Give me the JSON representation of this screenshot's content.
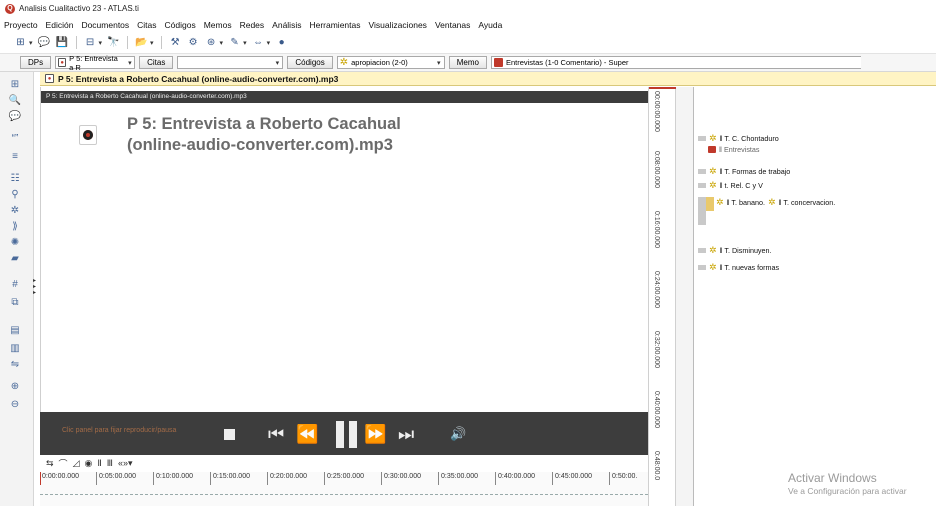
{
  "window": {
    "title": "Analisis Cualitactivo 23 - ATLAS.ti"
  },
  "menu": [
    "Proyecto",
    "Edición",
    "Documentos",
    "Citas",
    "Códigos",
    "Memos",
    "Redes",
    "Análisis",
    "Herramientas",
    "Visualizaciones",
    "Ventanas",
    "Ayuda"
  ],
  "toolbar2": {
    "dps_label": "DPs",
    "doc_select": "P 5: Entrevista a R",
    "citas_label": "Citas",
    "citas_select": "",
    "codigos_label": "Códigos",
    "codigos_select": "apropiacion (2-0)",
    "memo_label": "Memo",
    "memo_select": "Entrevistas (1-0 Comentario) - Super"
  },
  "document": {
    "header": "P 5: Entrevista a Roberto Cacahual (online-audio-converter.com).mp3",
    "bar": "P 5: Entrevista a Roberto Cacahual (online-audio-converter.com).mp3",
    "title_line1": "P 5: Entrevista a Roberto Cacahual",
    "title_line2": "(online-audio-converter.com).mp3"
  },
  "player": {
    "hint": "Clic panel para fijar reproducir/pausa",
    "prev_glyph": "⏮",
    "rew_glyph": "⏪",
    "fwd_glyph": "⏩",
    "next_glyph": "⏭",
    "vol_glyph": "🔊"
  },
  "timeline": {
    "tools": [
      "⇆",
      "⌒",
      "◿",
      "◉",
      "Ⅱ",
      "Ⅲ",
      "«»▾"
    ],
    "ticks": [
      "0:00:00.000",
      "0:05:00.000",
      "0:10:00.000",
      "0:15:00.000",
      "0:20:00.000",
      "0:25:00.000",
      "0:30:00.000",
      "0:35:00.000",
      "0:40:00.000",
      "0:45:00.000",
      "0:50:00."
    ]
  },
  "vertical_ruler": [
    "00:00:00.000",
    "0:08:00.000",
    "0:16:00.000",
    "0:24:00.000",
    "0:32:00.000",
    "0:40:00.000",
    "0:48:00.0"
  ],
  "codes": [
    {
      "label": "T. C. Chontaduro",
      "sub": "Entrevistas"
    },
    {
      "label": "T. Formas de trabajo"
    },
    {
      "label": "t. Rel. C y V"
    },
    {
      "label": "T. banano.",
      "label2": "T. concervacion."
    },
    {
      "label": "T. Disminuyen."
    },
    {
      "label": "T. nuevas formas"
    }
  ],
  "watermark": {
    "line1": "Activar Windows",
    "line2": "Ve a Configuración para activar"
  }
}
